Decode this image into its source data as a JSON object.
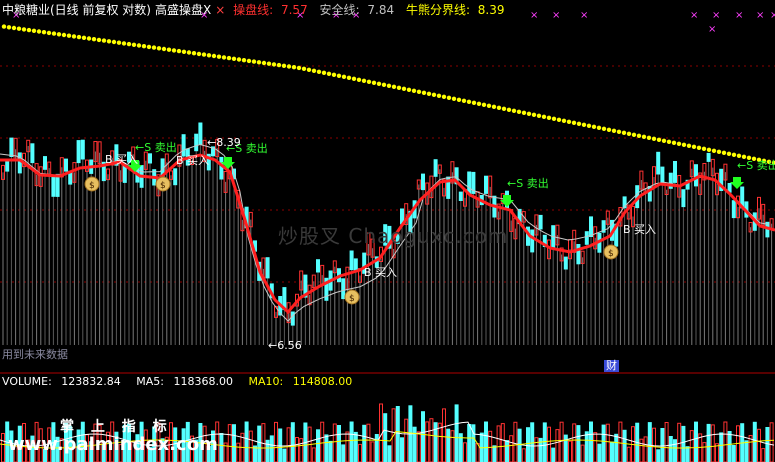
{
  "header": {
    "stock": "中粮糖业(日线 前复权 对数)",
    "indicator": "高盛操盘X",
    "operate_label": "操盘线: ",
    "operate_value": "7.57",
    "safety_label": "安全线: ",
    "safety_value": "7.84",
    "bullbear_label": "牛熊分界线: ",
    "bullbear_value": "8.39"
  },
  "volume_header": {
    "volume_label": "VOLUME: ",
    "volume_value": "123832.84",
    "ma5_label": "MA5: ",
    "ma5_value": "118368.00",
    "ma10_label": "MA10: ",
    "ma10_value": "114808.00"
  },
  "labels": {
    "sell": "←S 卖出",
    "buy": "B 买入",
    "high": "←8.39",
    "low": "←6.56",
    "future": "用到未来数据",
    "cai": "财",
    "watermark": "炒股叉 Chaoguxc.com",
    "brand_cn": "掌 上 指 标",
    "brand_url": "www.palmindex.com"
  },
  "colors": {
    "up": "#ff3232",
    "down": "#54ffff",
    "operate": "#ff2020",
    "safety": "#c8c8c8",
    "bullbear": "#ffff00",
    "sell_text": "#32ff32",
    "buy_text": "#ffffff",
    "ma5": "#ffffff",
    "ma10": "#ffff00"
  }
}
